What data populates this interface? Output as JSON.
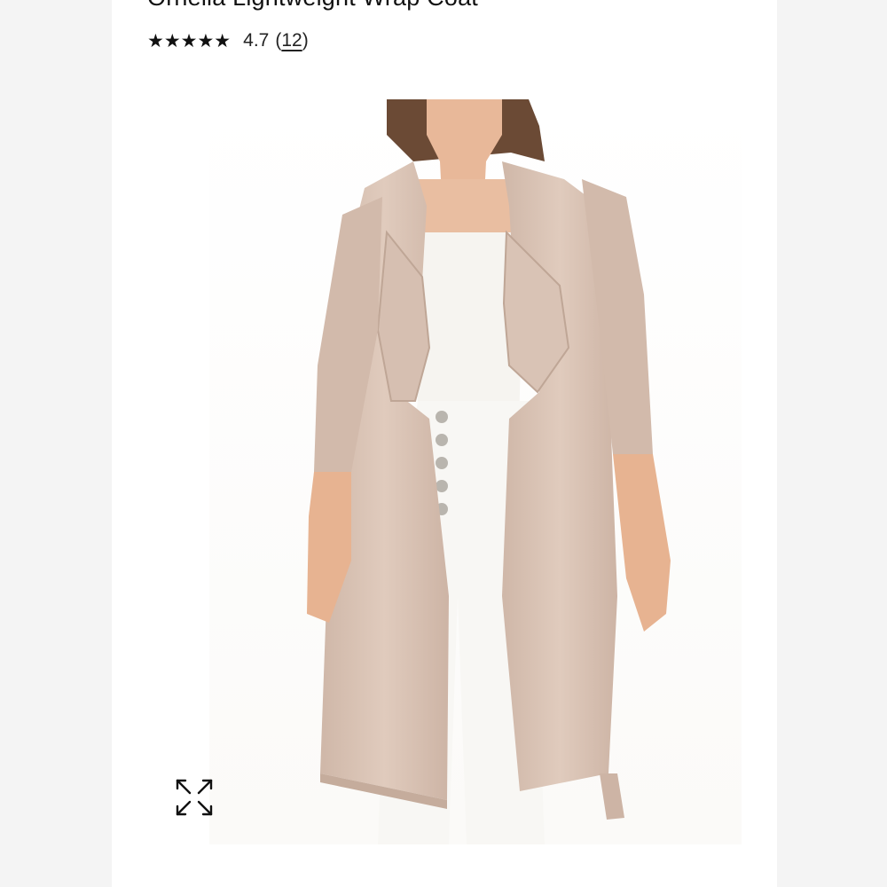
{
  "product": {
    "title": "Ornella Lightweight Wrap Coat",
    "stars": "★★★★★",
    "rating": "4.7",
    "review_count": "12",
    "paren_open": "(",
    "paren_close": ")"
  },
  "image": {
    "subject": "model wearing a light beige waterfall wrap coat over white top and white jeans",
    "colors": {
      "coat": "#dcc7b9",
      "coat_shadow": "#c9b1a2",
      "top": "#f6f4f0",
      "jeans": "#f8f7f4",
      "skin": "#e8b899",
      "hair": "#6b4a35",
      "buttons": "#b9b5ae"
    }
  },
  "controls": {
    "expand_icon": "expand-arrows-icon"
  }
}
